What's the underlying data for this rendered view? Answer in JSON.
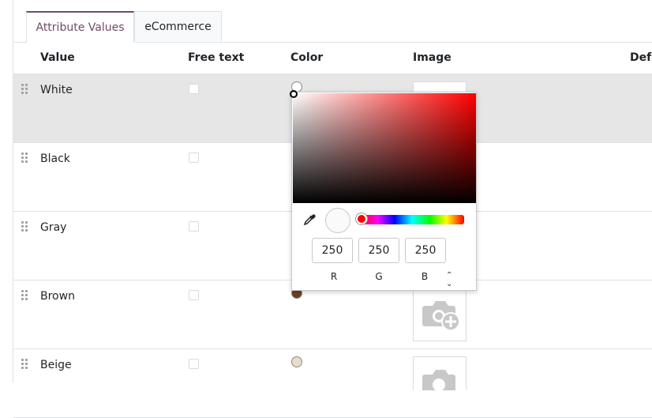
{
  "tabs": [
    {
      "label": "Attribute Values",
      "active": true
    },
    {
      "label": "eCommerce",
      "active": false
    }
  ],
  "columns": {
    "value": "Value",
    "free_text": "Free text",
    "color": "Color",
    "image": "Image",
    "default": "Defa"
  },
  "rows": [
    {
      "value": "White",
      "color": "#ffffff",
      "selected": true
    },
    {
      "value": "Black",
      "color": "#000000"
    },
    {
      "value": "Gray",
      "color": "#808080"
    },
    {
      "value": "Brown",
      "color": "#6b4226"
    },
    {
      "value": "Beige",
      "color": "#e8dccb"
    }
  ],
  "color_picker": {
    "r": "250",
    "g": "250",
    "b": "250",
    "r_label": "R",
    "g_label": "G",
    "b_label": "B",
    "mode_toggle_icon": "up-down-chevron-icon",
    "eyedropper_icon": "eyedropper-icon",
    "hue_color": "#ff0000"
  },
  "accent_color": "#714b67"
}
